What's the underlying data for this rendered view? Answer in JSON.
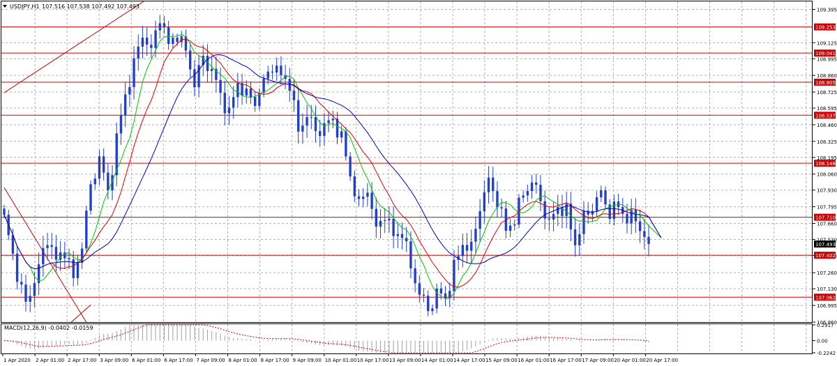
{
  "header": {
    "symbol_label": "USDJPY,H1",
    "ohlc_text": "107.516 107.538 107.492 107.493"
  },
  "chart_data": {
    "type": "candlestick",
    "symbol": "USDJPY",
    "timeframe": "H1",
    "ohlc": {
      "open": 107.516,
      "high": 107.538,
      "low": 107.492,
      "close": 107.493
    },
    "last_price": 107.493,
    "ylim": [
      106.86,
      109.46
    ],
    "price_ticks": [
      "109.395",
      "109.125",
      "108.995",
      "108.860",
      "108.725",
      "108.595",
      "108.460",
      "108.325",
      "108.195",
      "108.060",
      "107.930",
      "107.795",
      "107.660",
      "107.530",
      "107.400",
      "107.260",
      "107.130",
      "106.995",
      "106.860"
    ],
    "horizontal_levels": [
      {
        "label": "109.253",
        "value": 109.253
      },
      {
        "label": "109.041",
        "value": 109.041
      },
      {
        "label": "108.805",
        "value": 108.805
      },
      {
        "label": "108.537",
        "value": 108.537
      },
      {
        "label": "108.148",
        "value": 108.148
      },
      {
        "label": "107.710",
        "value": 107.71
      },
      {
        "label": "107.402",
        "value": 107.402
      },
      {
        "label": "107.062",
        "value": 107.062
      }
    ],
    "time_labels": [
      "1 Apr 2020",
      "2 Apr 01:00",
      "2 Apr 17:00",
      "3 Apr 09:00",
      "6 Apr 01:00",
      "6 Apr 17:00",
      "7 Apr 09:00",
      "8 Apr 01:00",
      "8 Apr 17:00",
      "9 Apr 09:00",
      "10 Apr 01:00",
      "10 Apr 17:00",
      "13 Apr 09:00",
      "14 Apr 01:00",
      "14 Apr 17:00",
      "15 Apr 09:00",
      "16 Apr 01:00",
      "16 Apr 17:00",
      "17 Apr 09:00",
      "20 Apr 01:00",
      "20 Apr 17:00"
    ],
    "price_path": [
      [
        0,
        107.7
      ],
      [
        3,
        107.25
      ],
      [
        5,
        107.0
      ],
      [
        8,
        107.3
      ],
      [
        10,
        107.55
      ],
      [
        12,
        107.35
      ],
      [
        14,
        107.45
      ],
      [
        16,
        107.2
      ],
      [
        18,
        107.5
      ],
      [
        20,
        107.95
      ],
      [
        22,
        108.2
      ],
      [
        24,
        107.9
      ],
      [
        26,
        108.35
      ],
      [
        28,
        108.7
      ],
      [
        30,
        108.95
      ],
      [
        32,
        109.2
      ],
      [
        34,
        109.05
      ],
      [
        36,
        109.35
      ],
      [
        38,
        109.1
      ],
      [
        40,
        109.2
      ],
      [
        42,
        109.05
      ],
      [
        44,
        108.8
      ],
      [
        46,
        109.0
      ],
      [
        48,
        108.9
      ],
      [
        50,
        108.7
      ],
      [
        52,
        108.55
      ],
      [
        54,
        108.8
      ],
      [
        56,
        108.7
      ],
      [
        58,
        108.65
      ],
      [
        60,
        108.8
      ],
      [
        62,
        108.95
      ],
      [
        64,
        108.85
      ],
      [
        66,
        108.8
      ],
      [
        68,
        108.4
      ],
      [
        70,
        108.55
      ],
      [
        72,
        108.4
      ],
      [
        74,
        108.45
      ],
      [
        76,
        108.5
      ],
      [
        78,
        108.35
      ],
      [
        80,
        108.05
      ],
      [
        82,
        107.8
      ],
      [
        84,
        107.95
      ],
      [
        86,
        107.6
      ],
      [
        88,
        107.75
      ],
      [
        90,
        107.55
      ],
      [
        92,
        107.6
      ],
      [
        94,
        107.3
      ],
      [
        96,
        107.1
      ],
      [
        98,
        106.95
      ],
      [
        100,
        107.1
      ],
      [
        102,
        107.05
      ],
      [
        104,
        107.3
      ],
      [
        106,
        107.5
      ],
      [
        108,
        107.45
      ],
      [
        110,
        107.8
      ],
      [
        112,
        108.0
      ],
      [
        114,
        107.85
      ],
      [
        116,
        107.6
      ],
      [
        118,
        107.7
      ],
      [
        120,
        107.9
      ],
      [
        122,
        108.0
      ],
      [
        124,
        107.85
      ],
      [
        126,
        107.65
      ],
      [
        128,
        107.8
      ],
      [
        130,
        107.75
      ],
      [
        132,
        107.5
      ],
      [
        134,
        107.7
      ],
      [
        136,
        107.8
      ],
      [
        138,
        107.9
      ],
      [
        140,
        107.75
      ],
      [
        142,
        107.8
      ],
      [
        144,
        107.7
      ],
      [
        146,
        107.7
      ],
      [
        148,
        107.55
      ],
      [
        149,
        107.493
      ]
    ],
    "ma_series": [
      {
        "color": "#00c800",
        "period": 7
      },
      {
        "color": "#e00000",
        "period": 12
      },
      {
        "color": "#0000d0",
        "period": 22
      }
    ],
    "trendlines": [
      {
        "x1": 0,
        "y1": 108.72,
        "x2": 44,
        "y2": 109.73
      },
      {
        "x1": 0,
        "y1": 107.95,
        "x2": 20,
        "y2": 106.8
      },
      {
        "x1": 12,
        "y1": 106.75,
        "x2": 20,
        "y2": 107.0
      }
    ],
    "macd": {
      "label": "MACD(12,26,9) -0.0402 -0.0159",
      "params": [
        12,
        26,
        9
      ],
      "main": -0.0402,
      "signal": -0.0159,
      "ticks": [
        "0.2917",
        "0.00",
        "-0.2242"
      ],
      "ylim": [
        -0.2242,
        0.2917
      ]
    }
  }
}
